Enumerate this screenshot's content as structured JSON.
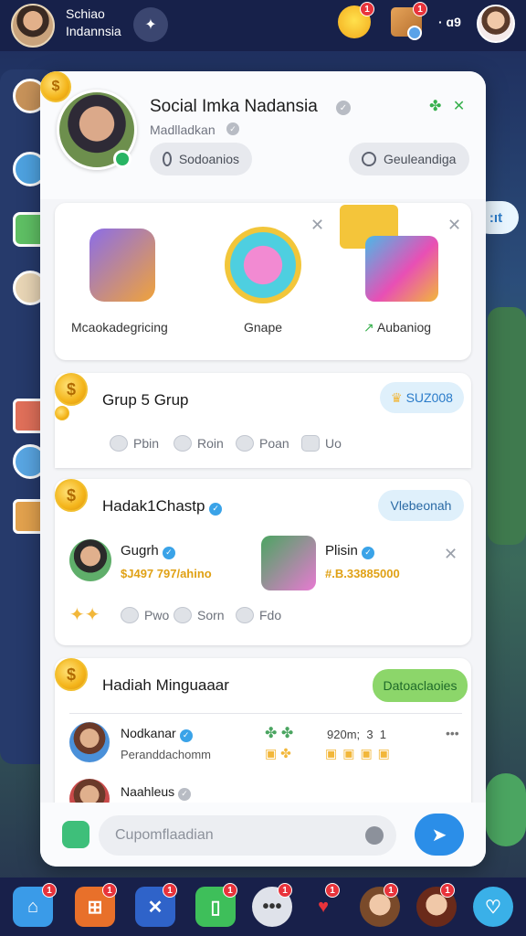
{
  "app": {
    "title_line1": "Schiao",
    "title_line2": "Indannsia",
    "notif_count_1": "1",
    "notif_count_2": "1",
    "counter_text": "· ɑ9"
  },
  "profile": {
    "name": "Social Imka Nadansia",
    "subtitle": "Madlladkan",
    "pill_left": "Sodoanios",
    "pill_right": "Geuleandiga"
  },
  "featured": {
    "tiles": [
      {
        "label": "Mcaokadegricing",
        "icon": "character-icon"
      },
      {
        "label": "Gnape",
        "icon": "game-orb-icon"
      },
      {
        "label": "Aubaniog",
        "icon": "gift-box-icon"
      }
    ]
  },
  "group": {
    "title": "Grup 5 Grup",
    "chip": "SUZ008",
    "actions": [
      "Pbin",
      "Roin",
      "Poan",
      "Uo"
    ]
  },
  "hadiah_card": {
    "title": "Hadak1Chastp",
    "chip": "Vlebeonah",
    "users": [
      {
        "name": "Gugrh",
        "value": "$J497 797/ahino"
      },
      {
        "name": "Plisin",
        "value": "#.B.33885000"
      }
    ],
    "actions": [
      "Pwo",
      "Sorn",
      "Fdo"
    ]
  },
  "weekly": {
    "title": "Hadiah Minguaaar",
    "chip": "Datoaclaoies",
    "rows": [
      {
        "name": "Nodkanar",
        "sub": "Peranddachomm",
        "stats": "920m;  3  1"
      },
      {
        "name": "Naahleus",
        "sub": "",
        "stats": ""
      }
    ],
    "more": "•••"
  },
  "composer": {
    "placeholder": "Cupomflaadian"
  },
  "dock": {
    "badges": [
      "1",
      "1",
      "1",
      "1",
      "1",
      "1",
      "1",
      "1"
    ]
  },
  "colors": {
    "accent_blue": "#2b8ee8",
    "accent_green": "#8cd66a",
    "coin_gold": "#f4b51b",
    "badge_red": "#e8333b"
  }
}
